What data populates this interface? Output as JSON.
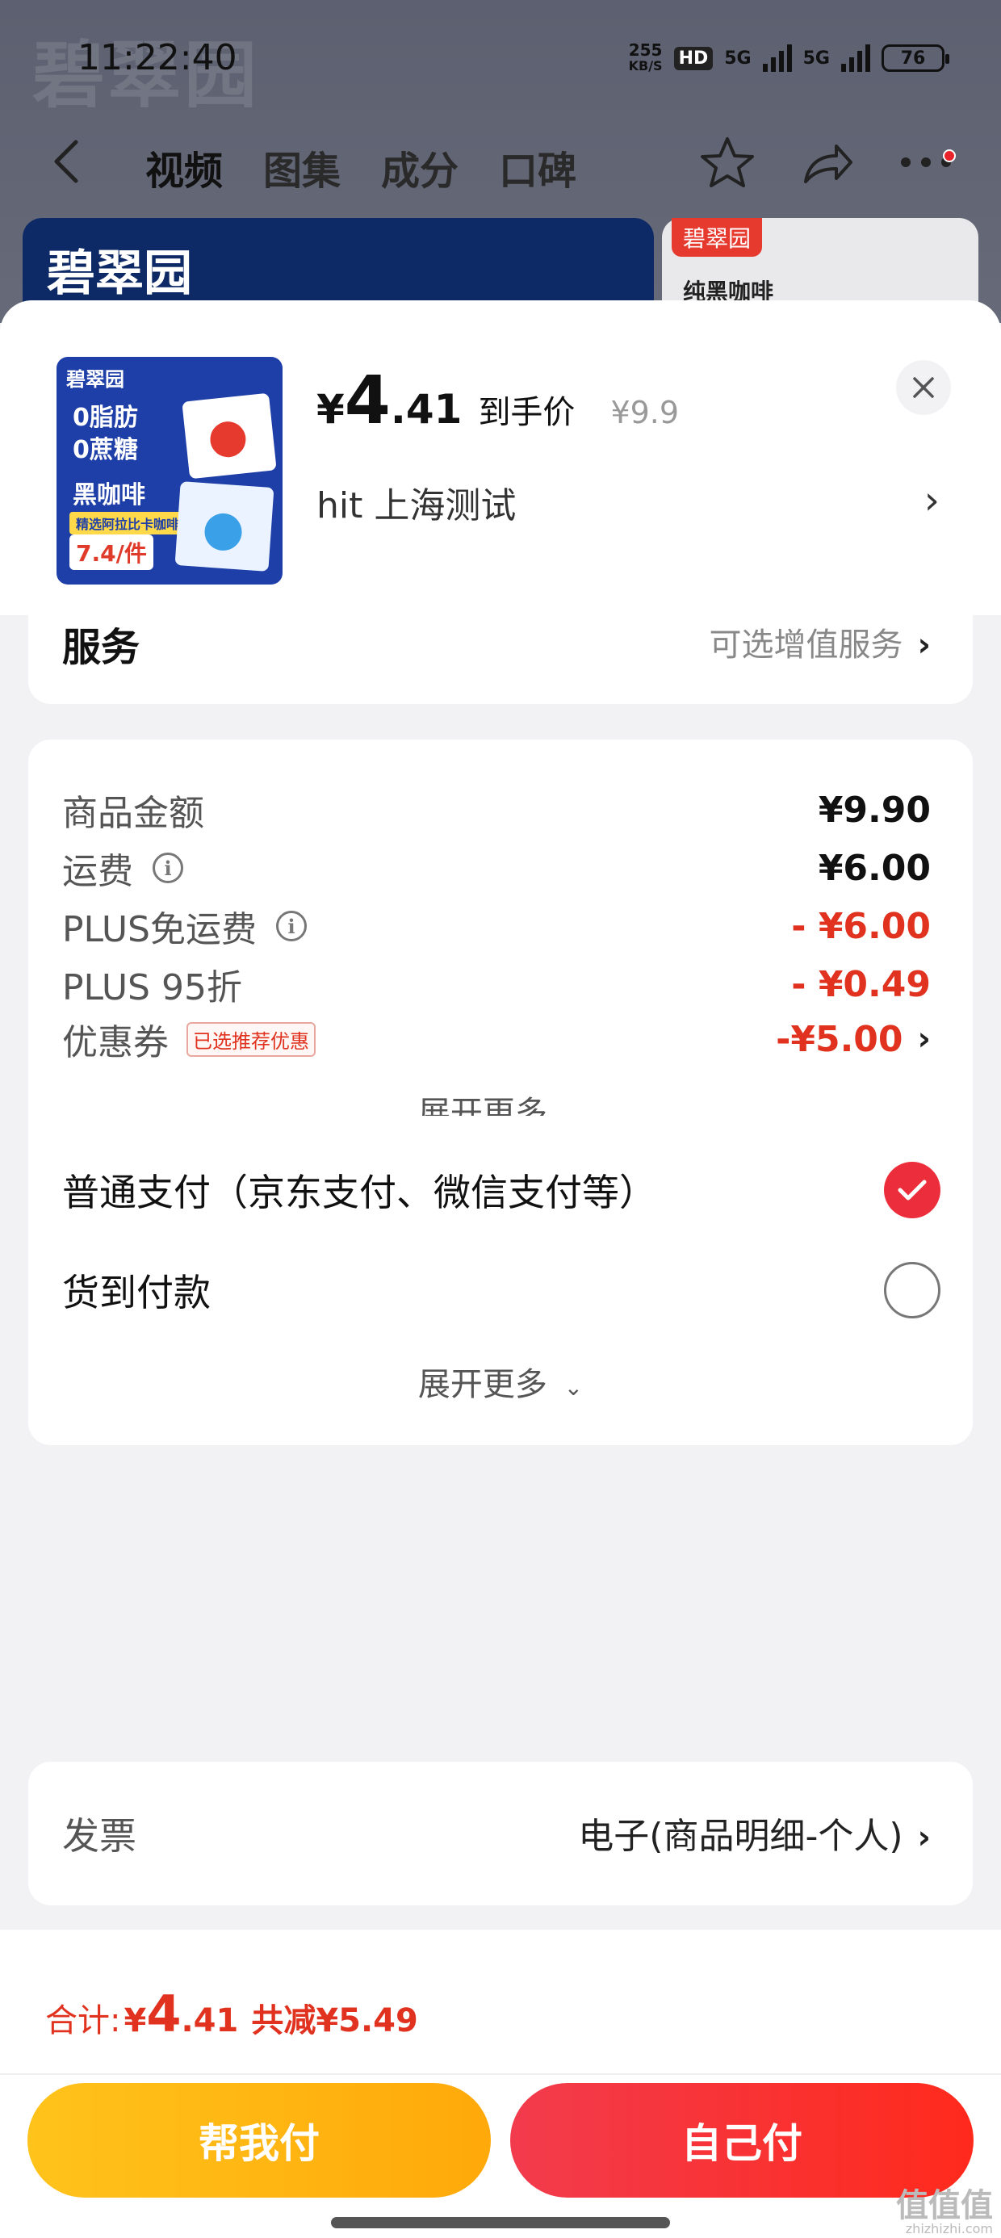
{
  "status_bar": {
    "time": "11:22:40",
    "speed": "255",
    "speed_unit": "KB/S",
    "hd": "HD",
    "net1": "5G",
    "net2": "5G",
    "battery": "76"
  },
  "nav": {
    "tabs": [
      "视频",
      "图集",
      "成分",
      "口碑"
    ]
  },
  "background": {
    "brand": "碧翠园",
    "card2_tag": "碧翠园",
    "card2_title": "纯黑咖啡"
  },
  "product": {
    "thumb_brand": "碧翠园",
    "thumb_line1": "0脂肪",
    "thumb_line2": "0蔗糖",
    "thumb_line3": "黑咖啡",
    "thumb_chip": "精选阿拉比卡咖啡豆",
    "thumb_price": "7.4/件",
    "price_yen": "¥",
    "price_int": "4",
    "price_dec": ".41",
    "price_label": "到手价",
    "price_orig": "¥9.9",
    "address": "hit  上海测试"
  },
  "service": {
    "title": "服务",
    "right": "可选增值服务"
  },
  "amounts": [
    {
      "label": "商品金额",
      "value": "¥9.90",
      "red": false,
      "info": false
    },
    {
      "label": "运费",
      "value": "¥6.00",
      "red": false,
      "info": true
    },
    {
      "label": "PLUS免运费",
      "value": "- ¥6.00",
      "red": true,
      "info": true
    },
    {
      "label": "PLUS 95折",
      "value": "- ¥0.49",
      "red": true,
      "info": false
    },
    {
      "label": "优惠券",
      "value": "-¥5.00",
      "red": true,
      "info": false,
      "tag": "已选推荐优惠"
    }
  ],
  "expand_more": "展开更多",
  "payment": {
    "options": [
      {
        "label": "普通支付（京东支付、微信支付等）",
        "checked": true
      },
      {
        "label": "货到付款",
        "checked": false
      }
    ]
  },
  "invoice": {
    "label": "发票",
    "value": "电子(商品明细-个人)"
  },
  "footer": {
    "total_label": "合计:",
    "total_yen": "¥",
    "total_int": "4",
    "total_dec": ".41",
    "total_save": "共减¥5.49",
    "btn_help": "帮我付",
    "btn_self": "自己付"
  },
  "watermark": {
    "text": "值值值",
    "sub": "zhizhizhi.com"
  },
  "colors": {
    "accent_red": "#e0321f",
    "pay_yellow": "#ffb412",
    "pay_red": "#f5302f"
  }
}
